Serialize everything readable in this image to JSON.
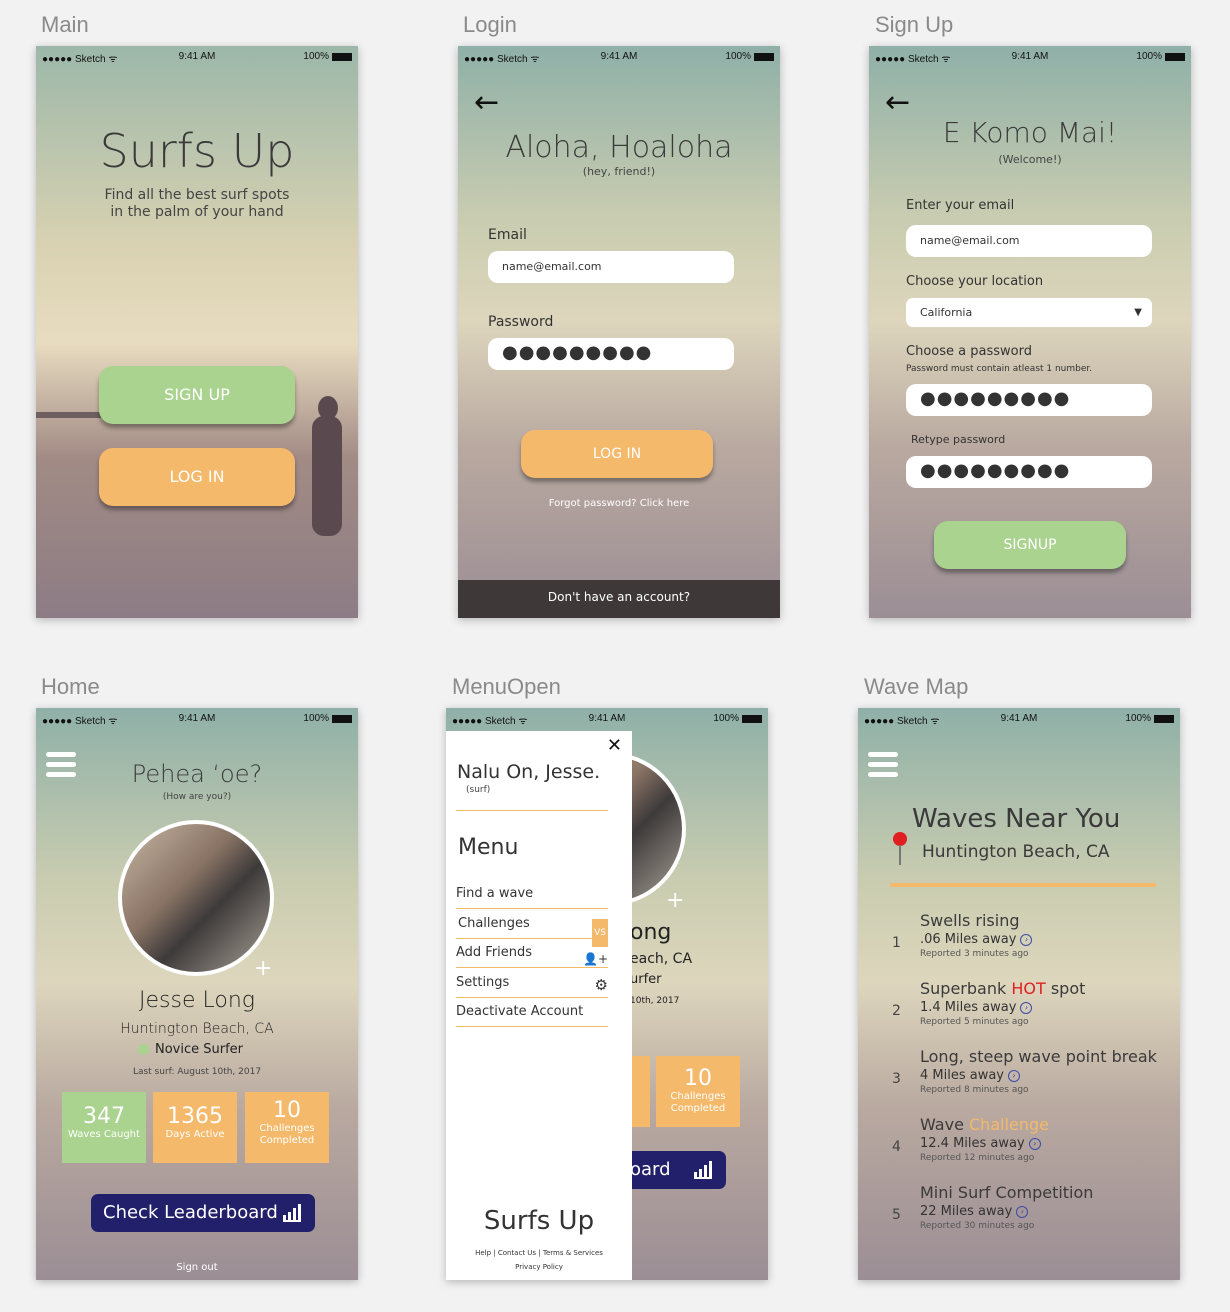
{
  "artboards": {
    "main": "Main",
    "login": "Login",
    "signup": "Sign Up",
    "home": "Home",
    "menu": "MenuOpen",
    "map": "Wave Map"
  },
  "status": {
    "carrier": "●●●●● Sketch ᯤ",
    "time": "9:41 AM",
    "battery": "100%"
  },
  "main": {
    "title": "Surfs Up",
    "tagline": "Find all the best surf spots in the palm of your hand",
    "signup_label": "SIGN UP",
    "login_label": "LOG IN"
  },
  "login": {
    "greeting": "Aloha, Hoaloha",
    "greeting_sub": "(hey, friend!)",
    "email_label": "Email",
    "email_value": "name@email.com",
    "password_label": "Password",
    "password_value": "●●●●●●●●●",
    "login_label": "LOG IN",
    "forgot": "Forgot password? Click here",
    "no_account": "Don't have an account?"
  },
  "signup": {
    "greeting": "E Komo Mai!",
    "greeting_sub": "(Welcome!)",
    "email_label": "Enter your email",
    "email_value": "name@email.com",
    "location_label": "Choose your location",
    "location_value": "California",
    "password_label": "Choose a password",
    "password_hint": "Password must contain atleast 1 number.",
    "password_value": "●●●●●●●●●",
    "retype_label": "Retype password",
    "retype_value": "●●●●●●●●●",
    "signup_label": "SIGNUP"
  },
  "home": {
    "greeting": "Pehea ʻoe?",
    "greeting_sub": "(How are you?)",
    "name": "Jesse Long",
    "location": "Huntington Beach, CA",
    "level": "Novice Surfer",
    "last_surf": "Last surf: August 10th, 2017",
    "stats": [
      {
        "num": "347",
        "label": "Waves Caught",
        "color": "#a9d38e"
      },
      {
        "num": "1365",
        "label": "Days Active",
        "color": "#f4b96a"
      },
      {
        "num": "10",
        "label": "Challenges Completed",
        "color": "#f4b96a"
      }
    ],
    "leaderboard": "Check Leaderboard",
    "sign_out": "Sign out"
  },
  "menu": {
    "greeting": "Nalu On, Jesse.",
    "greeting_sub": "(surf)",
    "heading": "Menu",
    "items": [
      {
        "label": "Find a wave",
        "icon": ""
      },
      {
        "label": "Challenges",
        "icon": "VS"
      },
      {
        "label": "Add Friends",
        "icon": "👤+"
      },
      {
        "label": "Settings",
        "icon": "⚙"
      },
      {
        "label": "Deactivate Account",
        "icon": ""
      }
    ],
    "brand": "Surfs Up",
    "footer_links": "Help | Contact Us | Terms & Services",
    "footer_policy": "Privacy Policy",
    "bg_name_partial": "ong",
    "bg_loc_partial": "each, CA",
    "bg_level_partial": "urfer",
    "bg_date_partial": "10th, 2017",
    "bg_stat_num": "10",
    "bg_stat_label": "Challenges Completed",
    "bg_leader_partial": "oard"
  },
  "map": {
    "title": "Waves Near You",
    "location": "Huntington Beach, CA",
    "waves": [
      {
        "n": "1",
        "title": "Swells rising",
        "dist": ".06 Miles away",
        "reported": "Reported 3 minutes ago"
      },
      {
        "n": "2",
        "title_pre": "Superbank ",
        "title_hi": "HOT",
        "title_post": " spot",
        "dist": "1.4 Miles away",
        "reported": "Reported 5 minutes ago"
      },
      {
        "n": "3",
        "title": "Long, steep wave point break",
        "dist": "4 Miles away",
        "reported": "Reported 8 minutes ago"
      },
      {
        "n": "4",
        "title_pre": "Wave ",
        "title_hi": "Challenge",
        "dist": "12.4 Miles away",
        "reported": "Reported 12 minutes ago"
      },
      {
        "n": "5",
        "title": "Mini Surf Competition",
        "dist": "22 Miles away",
        "reported": "Reported 30 minutes ago"
      }
    ]
  },
  "colors": {
    "green": "#a9d38e",
    "orange": "#f4b96a",
    "navy": "#22206b",
    "hot": "#e02020"
  }
}
